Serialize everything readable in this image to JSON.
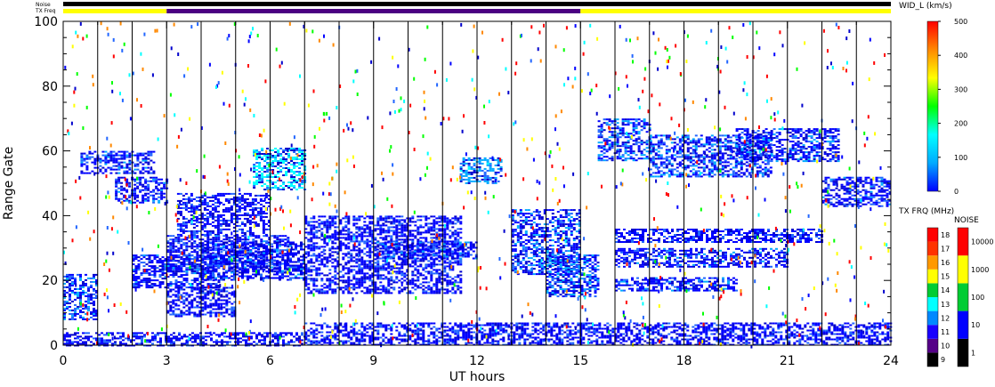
{
  "chart_data": {
    "type": "heatmap",
    "title": "",
    "xlabel": "UT hours",
    "ylabel": "Range Gate",
    "xlim": [
      0,
      24
    ],
    "ylim": [
      0,
      100
    ],
    "x_ticks": [
      "0",
      "3",
      "6",
      "9",
      "12",
      "15",
      "18",
      "21",
      "24"
    ],
    "y_ticks": [
      "0",
      "20",
      "40",
      "60",
      "80",
      "100"
    ],
    "header_bars": {
      "noise_label": "Noise",
      "txfreq_label": "TX Freq",
      "txfreq_segments": [
        {
          "start": 0,
          "end": 3,
          "color": "#ffff00"
        },
        {
          "start": 3,
          "end": 15,
          "color": "#4b0082"
        },
        {
          "start": 15,
          "end": 24,
          "color": "#ffff00"
        }
      ]
    },
    "width_colorbar": {
      "title": "WID_L (km/s)",
      "ticks": [
        "0",
        "100",
        "200",
        "300",
        "400",
        "500"
      ],
      "range": [
        0,
        500
      ],
      "colors": [
        "#0000ff",
        "#00aaff",
        "#00ffff",
        "#00ff00",
        "#ffff00",
        "#ff8800",
        "#ff0000"
      ]
    },
    "txfreq_colorbar": {
      "title": "TX FRQ (MHz)",
      "ticks": [
        "9",
        "10",
        "11",
        "12",
        "13",
        "14",
        "15",
        "16",
        "17",
        "18"
      ],
      "colors": [
        "#000000",
        "#550088",
        "#1a00ff",
        "#0088ff",
        "#00ffff",
        "#00cc33",
        "#ffff00",
        "#ff9900",
        "#ff3300",
        "#ff0000"
      ]
    },
    "noise_colorbar": {
      "title": "NOISE",
      "ticks": [
        "1",
        "10",
        "100",
        "1000",
        "10000"
      ],
      "colors": [
        "#000000",
        "#0000ff",
        "#00cc33",
        "#ffff00",
        "#ff0000"
      ]
    },
    "echo_regions": [
      {
        "t0": 0.0,
        "t1": 1.0,
        "g0": 8,
        "g1": 22,
        "width": 60
      },
      {
        "t0": 0.5,
        "t1": 2.6,
        "g0": 53,
        "g1": 60,
        "width": 50
      },
      {
        "t0": 1.5,
        "t1": 3.0,
        "g0": 44,
        "g1": 52,
        "width": 40
      },
      {
        "t0": 3.3,
        "t1": 6.0,
        "g0": 34,
        "g1": 47,
        "width": 30
      },
      {
        "t0": 3.0,
        "t1": 6.5,
        "g0": 23,
        "g1": 34,
        "width": 35
      },
      {
        "t0": 2.0,
        "t1": 4.5,
        "g0": 18,
        "g1": 28,
        "width": 40
      },
      {
        "t0": 3.0,
        "t1": 5.0,
        "g0": 9,
        "g1": 18,
        "width": 30
      },
      {
        "t0": 4.0,
        "t1": 7.0,
        "g0": 20,
        "g1": 32,
        "width": 40
      },
      {
        "t0": 5.5,
        "t1": 7.0,
        "g0": 48,
        "g1": 61,
        "width": 170
      },
      {
        "t0": 7.0,
        "t1": 11.5,
        "g0": 16,
        "g1": 40,
        "width": 20
      },
      {
        "t0": 9.0,
        "t1": 12.0,
        "g0": 27,
        "g1": 32,
        "width": 50
      },
      {
        "t0": 11.5,
        "t1": 12.7,
        "g0": 50,
        "g1": 58,
        "width": 110
      },
      {
        "t0": 13.0,
        "t1": 15.0,
        "g0": 22,
        "g1": 42,
        "width": 60
      },
      {
        "t0": 14.0,
        "t1": 15.5,
        "g0": 15,
        "g1": 28,
        "width": 70
      },
      {
        "t0": 15.5,
        "t1": 17.0,
        "g0": 57,
        "g1": 70,
        "width": 60
      },
      {
        "t0": 16.0,
        "t1": 22.0,
        "g0": 32,
        "g1": 36,
        "width": 30
      },
      {
        "t0": 16.0,
        "t1": 21.0,
        "g0": 24,
        "g1": 30,
        "width": 40
      },
      {
        "t0": 16.0,
        "t1": 19.5,
        "g0": 17,
        "g1": 21,
        "width": 50
      },
      {
        "t0": 17.0,
        "t1": 20.5,
        "g0": 52,
        "g1": 65,
        "width": 60
      },
      {
        "t0": 19.5,
        "t1": 22.5,
        "g0": 57,
        "g1": 67,
        "width": 50
      },
      {
        "t0": 22.0,
        "t1": 24.0,
        "g0": 43,
        "g1": 52,
        "width": 40
      },
      {
        "t0": 7.0,
        "t1": 24.0,
        "g0": 0,
        "g1": 7,
        "width": 10
      },
      {
        "t0": 0.0,
        "t1": 7.0,
        "g0": 0,
        "g1": 4,
        "width": 20
      }
    ]
  }
}
